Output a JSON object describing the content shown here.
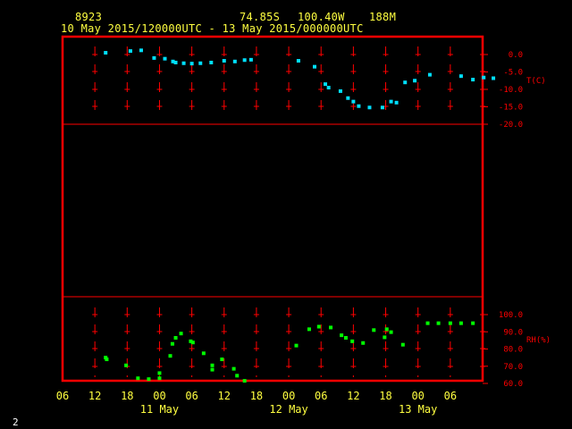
{
  "header": {
    "station": "8923",
    "lat": "74.85S",
    "lon": "100.40W",
    "elev": "188M",
    "range": "10 May 2015/120000UTC - 13 May 2015/000000UTC"
  },
  "page_number": "2",
  "colors": {
    "frame": "#ff0000",
    "text": "#ffff40",
    "temp": "#00e0ff",
    "rh": "#00ff00",
    "grid": "#ff0000"
  },
  "chart_data": [
    {
      "type": "scatter",
      "name": "temperature",
      "ylabel": "T(C)",
      "ylim": [
        -20,
        0
      ],
      "yticks": [
        "0.0",
        "-5.0",
        "-10.0",
        "-15.0",
        "-20.0"
      ],
      "ytick_values": [
        0,
        -5,
        -10,
        -15,
        -20
      ],
      "points": [
        {
          "x": 14.0,
          "y": 0.5
        },
        {
          "x": 18.6,
          "y": 1.0
        },
        {
          "x": 20.6,
          "y": 1.2
        },
        {
          "x": 23.0,
          "y": -1.0
        },
        {
          "x": 25.0,
          "y": -1.2
        },
        {
          "x": 26.5,
          "y": -2.0
        },
        {
          "x": 27.0,
          "y": -2.3
        },
        {
          "x": 28.5,
          "y": -2.5
        },
        {
          "x": 30.0,
          "y": -2.6
        },
        {
          "x": 31.6,
          "y": -2.5
        },
        {
          "x": 33.6,
          "y": -2.3
        },
        {
          "x": 36.0,
          "y": -1.8
        },
        {
          "x": 38.0,
          "y": -2.0
        },
        {
          "x": 39.8,
          "y": -1.6
        },
        {
          "x": 41.0,
          "y": -1.5
        },
        {
          "x": 49.8,
          "y": -1.8
        },
        {
          "x": 52.8,
          "y": -3.5
        },
        {
          "x": 54.8,
          "y": -8.5
        },
        {
          "x": 55.4,
          "y": -9.5
        },
        {
          "x": 57.6,
          "y": -10.5
        },
        {
          "x": 59.0,
          "y": -12.5
        },
        {
          "x": 60.0,
          "y": -13.5
        },
        {
          "x": 61.0,
          "y": -14.8
        },
        {
          "x": 63.0,
          "y": -15.2
        },
        {
          "x": 65.4,
          "y": -15.2
        },
        {
          "x": 67.0,
          "y": -13.5
        },
        {
          "x": 68.0,
          "y": -13.8
        },
        {
          "x": 69.6,
          "y": -8.0
        },
        {
          "x": 71.4,
          "y": -7.5
        },
        {
          "x": 74.2,
          "y": -5.8
        },
        {
          "x": 80.0,
          "y": -6.2
        },
        {
          "x": 82.2,
          "y": -7.2
        },
        {
          "x": 84.2,
          "y": -6.6
        },
        {
          "x": 86.0,
          "y": -6.8
        }
      ]
    },
    {
      "type": "scatter",
      "name": "relative humidity",
      "ylabel": "RH(%)",
      "ylim": [
        60,
        100
      ],
      "yticks": [
        "100.0",
        "90.0",
        "80.0",
        "70.0",
        "60.0"
      ],
      "ytick_values": [
        100,
        90,
        80,
        70,
        60
      ],
      "points": [
        {
          "x": 14.0,
          "y": 75.0
        },
        {
          "x": 14.2,
          "y": 74.0
        },
        {
          "x": 17.8,
          "y": 70.5
        },
        {
          "x": 20.0,
          "y": 63.0
        },
        {
          "x": 22.0,
          "y": 62.5
        },
        {
          "x": 24.0,
          "y": 63.0
        },
        {
          "x": 24.0,
          "y": 66.0
        },
        {
          "x": 26.0,
          "y": 76.0
        },
        {
          "x": 26.4,
          "y": 83.0
        },
        {
          "x": 27.0,
          "y": 86.5
        },
        {
          "x": 28.0,
          "y": 89.0
        },
        {
          "x": 29.8,
          "y": 84.5
        },
        {
          "x": 30.2,
          "y": 83.8
        },
        {
          "x": 32.2,
          "y": 77.5
        },
        {
          "x": 33.8,
          "y": 70.5
        },
        {
          "x": 33.8,
          "y": 68.0
        },
        {
          "x": 35.6,
          "y": 74.0
        },
        {
          "x": 37.8,
          "y": 68.5
        },
        {
          "x": 38.4,
          "y": 64.5
        },
        {
          "x": 39.8,
          "y": 61.5
        },
        {
          "x": 49.4,
          "y": 82.0
        },
        {
          "x": 51.8,
          "y": 91.5
        },
        {
          "x": 53.6,
          "y": 93.0
        },
        {
          "x": 55.8,
          "y": 92.5
        },
        {
          "x": 57.8,
          "y": 88.0
        },
        {
          "x": 58.6,
          "y": 86.5
        },
        {
          "x": 59.8,
          "y": 84.5
        },
        {
          "x": 61.8,
          "y": 83.5
        },
        {
          "x": 63.8,
          "y": 91.0
        },
        {
          "x": 65.8,
          "y": 86.8
        },
        {
          "x": 66.2,
          "y": 91.5
        },
        {
          "x": 67.0,
          "y": 89.8
        },
        {
          "x": 69.2,
          "y": 82.5
        },
        {
          "x": 73.8,
          "y": 95.0
        },
        {
          "x": 75.8,
          "y": 95.0
        },
        {
          "x": 78.0,
          "y": 95.0
        },
        {
          "x": 80.0,
          "y": 95.0
        },
        {
          "x": 82.2,
          "y": 95.0
        }
      ]
    }
  ],
  "x_axis": {
    "hour_labels": [
      "06",
      "12",
      "18",
      "00",
      "06",
      "12",
      "18",
      "00",
      "06",
      "12",
      "18",
      "00",
      "06"
    ],
    "day_labels": [
      {
        "label": "11 May",
        "hour": 24
      },
      {
        "label": "12 May",
        "hour": 48
      },
      {
        "label": "13 May",
        "hour": 72
      }
    ]
  }
}
